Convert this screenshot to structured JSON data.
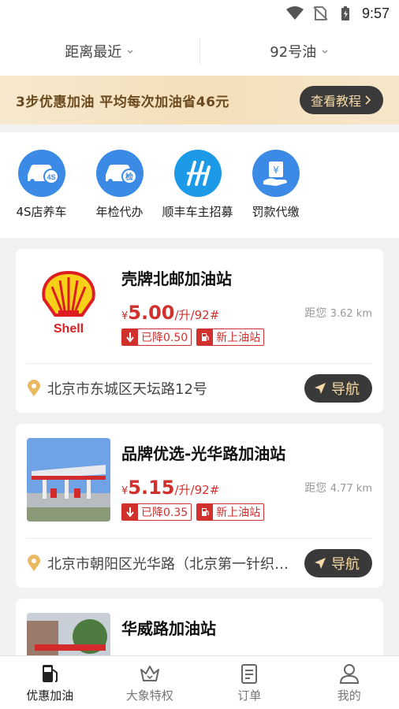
{
  "status_bar": {
    "time": "9:57",
    "icons": [
      "wifi-icon",
      "no-sim-icon",
      "battery-icon"
    ]
  },
  "filters": {
    "sort": "距离最近",
    "fuel": "92号油"
  },
  "promo": {
    "text": "3步优惠加油  平均每次加油省46元",
    "button": "查看教程"
  },
  "services": [
    {
      "label": "4S店养车",
      "icon": "car-4s-icon",
      "badge": "4S"
    },
    {
      "label": "年检代办",
      "icon": "car-inspection-icon",
      "badge": "检"
    },
    {
      "label": "顺丰车主招募",
      "icon": "highway-icon",
      "badge": ""
    },
    {
      "label": "罚款代缴",
      "icon": "fine-payment-icon",
      "badge": "¥"
    }
  ],
  "stations": [
    {
      "name": "壳牌北邮加油站",
      "yen": "¥",
      "price": "5.00",
      "unit": "/升/92#",
      "distance_label": "距您",
      "distance": "3.62 km",
      "tag1": "已降0.50",
      "tag2": "新上油站",
      "address": "北京市东城区天坛路12号",
      "nav": "导航",
      "logo_text": "Shell"
    },
    {
      "name": "品牌优选-光华路加油站",
      "yen": "¥",
      "price": "5.15",
      "unit": "/升/92#",
      "distance_label": "距您",
      "distance": "4.77 km",
      "tag1": "已降0.35",
      "tag2": "新上油站",
      "address": "北京市朝阳区光华路（北京第一针织…",
      "nav": "导航"
    },
    {
      "name": "华威路加油站",
      "yen": "¥",
      "price": "",
      "unit": "",
      "distance_label": "",
      "distance": "",
      "tag1": "",
      "tag2": "",
      "address": "",
      "nav": ""
    }
  ],
  "tabbar": [
    {
      "label": "优惠加油",
      "icon": "fuel-pump-icon",
      "active": true
    },
    {
      "label": "大象特权",
      "icon": "crown-icon",
      "active": false
    },
    {
      "label": "订单",
      "icon": "order-list-icon",
      "active": false
    },
    {
      "label": "我的",
      "icon": "user-icon",
      "active": false
    }
  ],
  "colors": {
    "accent_red": "#d0312d",
    "service_blue": "#3b8be6",
    "gold": "#f5d9a8",
    "dark": "#3a3939"
  }
}
